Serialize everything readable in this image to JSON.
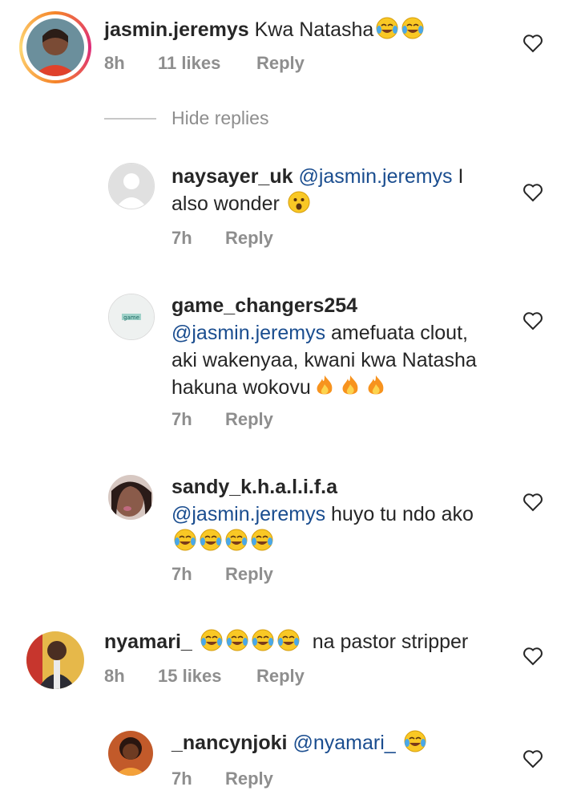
{
  "colors": {
    "username": "#262626",
    "mention": "#1a4d8f",
    "meta": "#8e8e8e"
  },
  "icons": {
    "like": "heart-outline-icon",
    "laugh": "face-with-tears-of-joy-emoji",
    "wow": "astonished-face-emoji",
    "fire": "fire-emoji"
  },
  "comments": [
    {
      "username": "jasmin.jeremys",
      "text": "Kwa Natasha",
      "time": "8h",
      "likes": "11 likes",
      "reply": "Reply"
    },
    {
      "username": "naysayer_uk",
      "mention": "@jasmin.jeremys",
      "text": "I also wonder",
      "time": "7h",
      "reply": "Reply"
    },
    {
      "username": "game_changers254",
      "mention": "@jasmin.jeremys",
      "text": "amefuata clout, aki wakenyaa, kwani kwa Natasha hakuna wokovu",
      "time": "7h",
      "reply": "Reply",
      "avatar_text": "game"
    },
    {
      "username": "sandy_k.h.a.l.i.f.a",
      "mention": "@jasmin.jeremys",
      "text": "huyo tu ndo ako",
      "time": "7h",
      "reply": "Reply"
    },
    {
      "username": "nyamari_",
      "text": "na pastor stripper",
      "time": "8h",
      "likes": "15 likes",
      "reply": "Reply"
    },
    {
      "username": "_nancynjoki",
      "mention": "@nyamari_",
      "text": "",
      "time": "7h",
      "reply": "Reply"
    }
  ],
  "hide_replies": "Hide replies"
}
